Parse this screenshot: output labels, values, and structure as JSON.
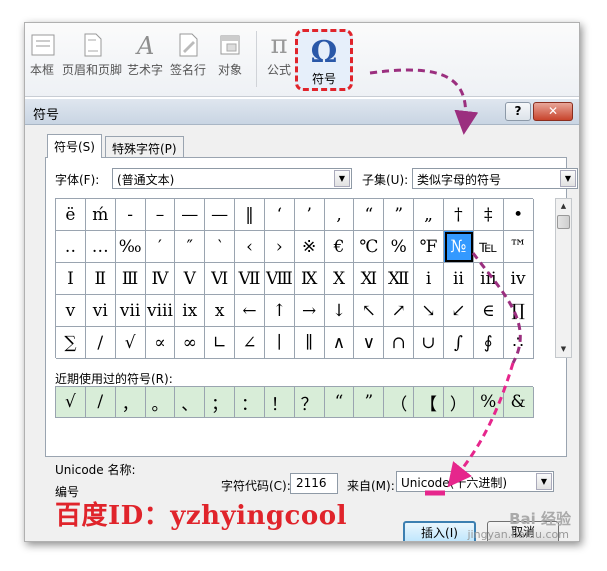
{
  "ribbon": {
    "items": [
      {
        "label": "本框",
        "icon": "text-box-icon"
      },
      {
        "label": "页眉和页脚",
        "icon": "header-footer-icon"
      },
      {
        "label": "艺术字",
        "icon": "wordart-icon"
      },
      {
        "label": "签名行",
        "icon": "signature-line-icon"
      },
      {
        "label": "对象",
        "icon": "object-icon"
      },
      {
        "label": "公式",
        "icon": "equation-icon"
      }
    ],
    "symbol": {
      "label": "符号",
      "glyph": "Ω"
    },
    "equation_glyph": "π"
  },
  "dialog": {
    "title": "符号",
    "help": "?",
    "close": "✕",
    "tabs": [
      "符号(S)",
      "特殊字符(P)"
    ],
    "font_label": "字体(F):",
    "font_value": "(普通文本)",
    "subset_label": "子集(U):",
    "subset_value": "类似字母的符号",
    "symbols": [
      [
        "ë",
        "ḿ",
        "-",
        "–",
        "—",
        "—",
        "‖",
        "‘",
        "’",
        ",",
        "“",
        "”",
        "„",
        "†",
        "‡",
        "•"
      ],
      [
        "‥",
        "…",
        "‰",
        "′",
        "″",
        "‵",
        "‹",
        "›",
        "※",
        "€",
        "℃",
        "%",
        "℉",
        "№",
        "℡",
        "™"
      ],
      [
        "Ⅰ",
        "Ⅱ",
        "Ⅲ",
        "Ⅳ",
        "Ⅴ",
        "Ⅵ",
        "Ⅶ",
        "Ⅷ",
        "Ⅸ",
        "Ⅹ",
        "Ⅺ",
        "Ⅻ",
        "ⅰ",
        "ⅱ",
        "ⅲ",
        "ⅳ"
      ],
      [
        "ⅴ",
        "ⅵ",
        "ⅶ",
        "ⅷ",
        "ⅸ",
        "ⅹ",
        "←",
        "↑",
        "→",
        "↓",
        "↖",
        "↗",
        "↘",
        "↙",
        "∈",
        "∏"
      ],
      [
        "∑",
        "∕",
        "√",
        "∝",
        "∞",
        "∟",
        "∠",
        "∣",
        "∥",
        "∧",
        "∨",
        "∩",
        "∪",
        "∫",
        "∮",
        "∴"
      ]
    ],
    "selected_symbol": "№",
    "recent_label": "近期使用过的符号(R):",
    "recent": [
      "√",
      "/",
      "，",
      "。",
      "、",
      "；",
      "：",
      "！",
      "？",
      "“",
      "”",
      "（",
      "【",
      "）",
      "%",
      "&"
    ],
    "unicode_name_label": "Unicode 名称:",
    "unicode_name_value": "编号",
    "char_code_label": "字符代码(C):",
    "char_code_value": "2116",
    "from_label": "来自(M):",
    "from_value": "Unicode(十六进制)",
    "insert_button": "插入(I)",
    "cancel_button": "取消"
  },
  "watermark": "百度ID：yzhyingcool",
  "brand": "Bai 经验",
  "url": "jingyan.baidu.com",
  "colors": {
    "highlight": "#e0242b",
    "arrow": "#9b2f7f",
    "pink_arrow": "#e6268c",
    "selection": "#3399ff",
    "recent_bg": "#d8edd8"
  }
}
